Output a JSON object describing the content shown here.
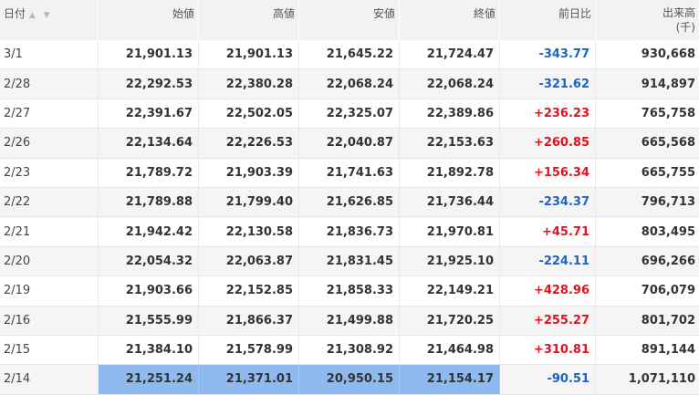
{
  "table": {
    "headers": {
      "date": "日付",
      "open": "始値",
      "high": "高値",
      "low": "安値",
      "close": "終値",
      "change": "前日比",
      "volume": "出来高",
      "volume_unit": "(千)",
      "sort_icons": "▲ ▼"
    },
    "rows": [
      {
        "date": "3/1",
        "open": "21,901.13",
        "high": "21,901.13",
        "low": "21,645.22",
        "close": "21,724.47",
        "change": "-343.77",
        "volume": "930,668"
      },
      {
        "date": "2/28",
        "open": "22,292.53",
        "high": "22,380.28",
        "low": "22,068.24",
        "close": "22,068.24",
        "change": "-321.62",
        "volume": "914,897"
      },
      {
        "date": "2/27",
        "open": "22,391.67",
        "high": "22,502.05",
        "low": "22,325.07",
        "close": "22,389.86",
        "change": "+236.23",
        "volume": "765,758"
      },
      {
        "date": "2/26",
        "open": "22,134.64",
        "high": "22,226.53",
        "low": "22,040.87",
        "close": "22,153.63",
        "change": "+260.85",
        "volume": "665,568"
      },
      {
        "date": "2/23",
        "open": "21,789.72",
        "high": "21,903.39",
        "low": "21,741.63",
        "close": "21,892.78",
        "change": "+156.34",
        "volume": "665,755"
      },
      {
        "date": "2/22",
        "open": "21,789.88",
        "high": "21,799.40",
        "low": "21,626.85",
        "close": "21,736.44",
        "change": "-234.37",
        "volume": "796,713"
      },
      {
        "date": "2/21",
        "open": "21,942.42",
        "high": "22,130.58",
        "low": "21,836.73",
        "close": "21,970.81",
        "change": "+45.71",
        "volume": "803,495"
      },
      {
        "date": "2/20",
        "open": "22,054.32",
        "high": "22,063.87",
        "low": "21,831.45",
        "close": "21,925.10",
        "change": "-224.11",
        "volume": "696,266"
      },
      {
        "date": "2/19",
        "open": "21,903.66",
        "high": "22,152.85",
        "low": "21,858.33",
        "close": "22,149.21",
        "change": "+428.96",
        "volume": "706,079"
      },
      {
        "date": "2/16",
        "open": "21,555.99",
        "high": "21,866.37",
        "low": "21,499.88",
        "close": "21,720.25",
        "change": "+255.27",
        "volume": "801,702"
      },
      {
        "date": "2/15",
        "open": "21,384.10",
        "high": "21,578.99",
        "low": "21,308.92",
        "close": "21,464.98",
        "change": "+310.81",
        "volume": "891,144"
      },
      {
        "date": "2/14",
        "open": "21,251.24",
        "high": "21,371.01",
        "low": "20,950.15",
        "close": "21,154.17",
        "change": "-90.51",
        "volume": "1,071,110"
      }
    ],
    "colors": {
      "negative": "#1e63c4",
      "positive": "#e0141e",
      "highlight": "#8fbaf0"
    }
  }
}
